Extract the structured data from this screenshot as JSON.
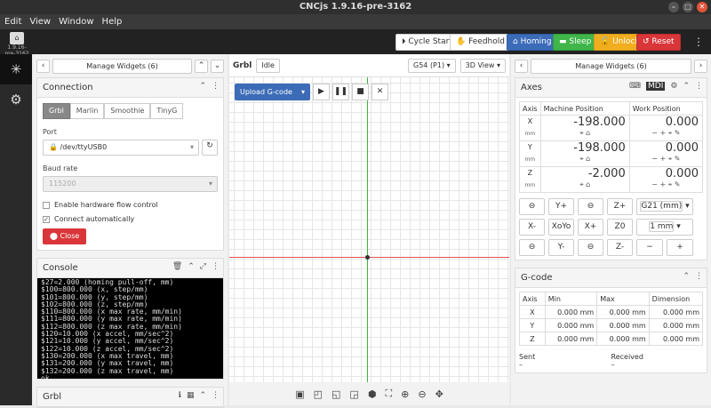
{
  "app": {
    "title": "CNCjs 1.9.16-pre-3162",
    "version": "1.9.16-pre-3162"
  },
  "menu": [
    "Edit",
    "View",
    "Window",
    "Help"
  ],
  "nav": {
    "cycle_start": "Cycle Start",
    "feedhold": "Feedhold",
    "homing": "Homing",
    "sleep": "Sleep",
    "unlock": "Unlock",
    "reset": "Reset"
  },
  "left": {
    "manage_widgets": "Manage Widgets (6)",
    "connection": {
      "title": "Connection",
      "tabs": [
        "Grbl",
        "Marlin",
        "Smoothie",
        "TinyG"
      ],
      "port_label": "Port",
      "port_value": "/dev/ttyUSB0",
      "baud_label": "Baud rate",
      "baud_value": "115200",
      "hw_flow": "Enable hardware flow control",
      "auto_connect": "Connect automatically",
      "close": "Close"
    },
    "console": {
      "title": "Console",
      "lines": [
        "$27=2.000 (homing pull-off, mm)",
        "$100=800.000 (x, step/mm)",
        "$101=800.000 (y, step/mm)",
        "$102=800.000 (z, step/mm)",
        "$110=800.000 (x max rate, mm/min)",
        "$111=800.000 (y max rate, mm/min)",
        "$112=800.000 (z max rate, mm/min)",
        "$120=10.000 (x accel, mm/sec^2)",
        "$121=10.000 (y accel, mm/sec^2)",
        "$122=10.000 (z accel, mm/sec^2)",
        "$130=200.000 (x max travel, mm)",
        "$131=200.000 (y max travel, mm)",
        "$132=200.000 (z max travel, mm)",
        "ok"
      ],
      "prompt": "> "
    },
    "grbl_title": "Grbl"
  },
  "middle": {
    "title": "Grbl",
    "state": "Idle",
    "wcs": "G54 (P1)",
    "view": "3D View",
    "upload": "Upload G-code"
  },
  "right": {
    "manage_widgets": "Manage Widgets (6)",
    "axes": {
      "title": "Axes",
      "mdi": "MDI",
      "headers": [
        "Axis",
        "Machine Position",
        "Work Position"
      ],
      "rows": [
        {
          "axis": "X",
          "unit": "mm",
          "machine": "-198.000",
          "work": "0.000"
        },
        {
          "axis": "Y",
          "unit": "mm",
          "machine": "-198.000",
          "work": "0.000"
        },
        {
          "axis": "Z",
          "unit": "mm",
          "machine": "-2.000",
          "work": "0.000"
        }
      ],
      "jog": [
        "Y+",
        "Z+",
        "G21 (mm)",
        "X-",
        "XoYo",
        "X+",
        "Z0",
        "1 mm",
        "Y-",
        "Z-",
        "−",
        "+"
      ]
    },
    "gcode": {
      "title": "G-code",
      "headers": [
        "Axis",
        "Min",
        "Max",
        "Dimension"
      ],
      "rows": [
        {
          "axis": "X",
          "min": "0.000 mm",
          "max": "0.000 mm",
          "dim": "0.000 mm"
        },
        {
          "axis": "Y",
          "min": "0.000 mm",
          "max": "0.000 mm",
          "dim": "0.000 mm"
        },
        {
          "axis": "Z",
          "min": "0.000 mm",
          "max": "0.000 mm",
          "dim": "0.000 mm"
        }
      ],
      "sent_label": "Sent",
      "sent_value": "–",
      "received_label": "Received",
      "received_value": "–"
    }
  }
}
